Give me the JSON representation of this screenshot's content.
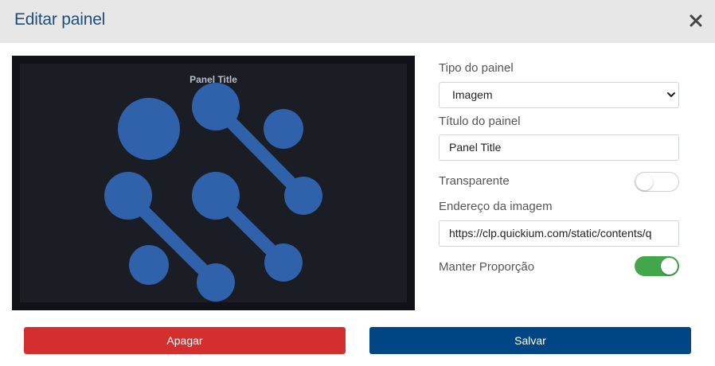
{
  "dialog": {
    "title": "Editar painel",
    "close_icon": "close-icon"
  },
  "preview": {
    "panel_title": "Panel Title",
    "logo_icon": "molecule-logo",
    "logo_color": "#2f62ab",
    "background": "#1b1d24"
  },
  "form": {
    "panel_type": {
      "label": "Tipo do painel",
      "value": "Imagem"
    },
    "panel_title": {
      "label": "Título do painel",
      "value": "Panel Title"
    },
    "transparent": {
      "label": "Transparente",
      "state": "off"
    },
    "image_url": {
      "label": "Endereço da imagem",
      "value": "https://clp.quickium.com/static/contents/q"
    },
    "keep_ratio": {
      "label": "Manter Proporção",
      "state": "on",
      "color": "#44a64b"
    }
  },
  "actions": {
    "delete_label": "Apagar",
    "delete_color": "#d32f2f",
    "save_label": "Salvar",
    "save_color": "#004685"
  }
}
